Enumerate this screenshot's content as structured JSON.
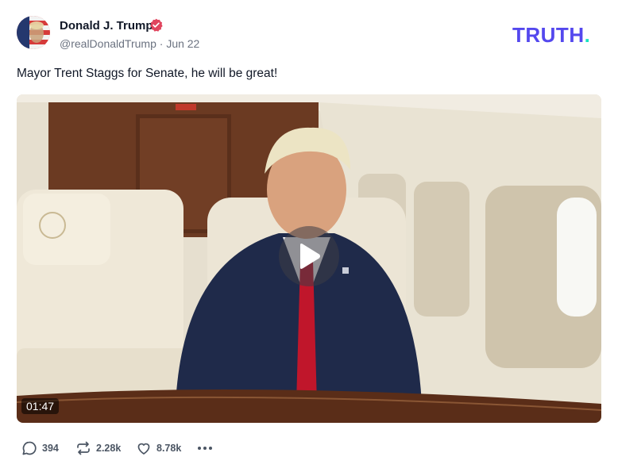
{
  "post": {
    "author": {
      "name": "Donald J. Trump",
      "handle": "@realDonaldTrump",
      "date": "Jun 22",
      "separator": "·",
      "verified_color": "#e0445d"
    },
    "logo": {
      "text": "TRUTH",
      "dot": ".",
      "color": "#5448ee",
      "dot_color": "#19e3c1"
    },
    "text": "Mayor Trent Staggs for Senate, he will be great!",
    "video": {
      "duration": "01:47",
      "icon": "play-icon"
    },
    "actions": {
      "replies": "394",
      "retruths": "2.28k",
      "likes": "8.78k",
      "reply_icon": "comment-icon",
      "retruth_icon": "retruth-icon",
      "like_icon": "heart-icon",
      "more_icon": "more-dots-icon"
    }
  }
}
